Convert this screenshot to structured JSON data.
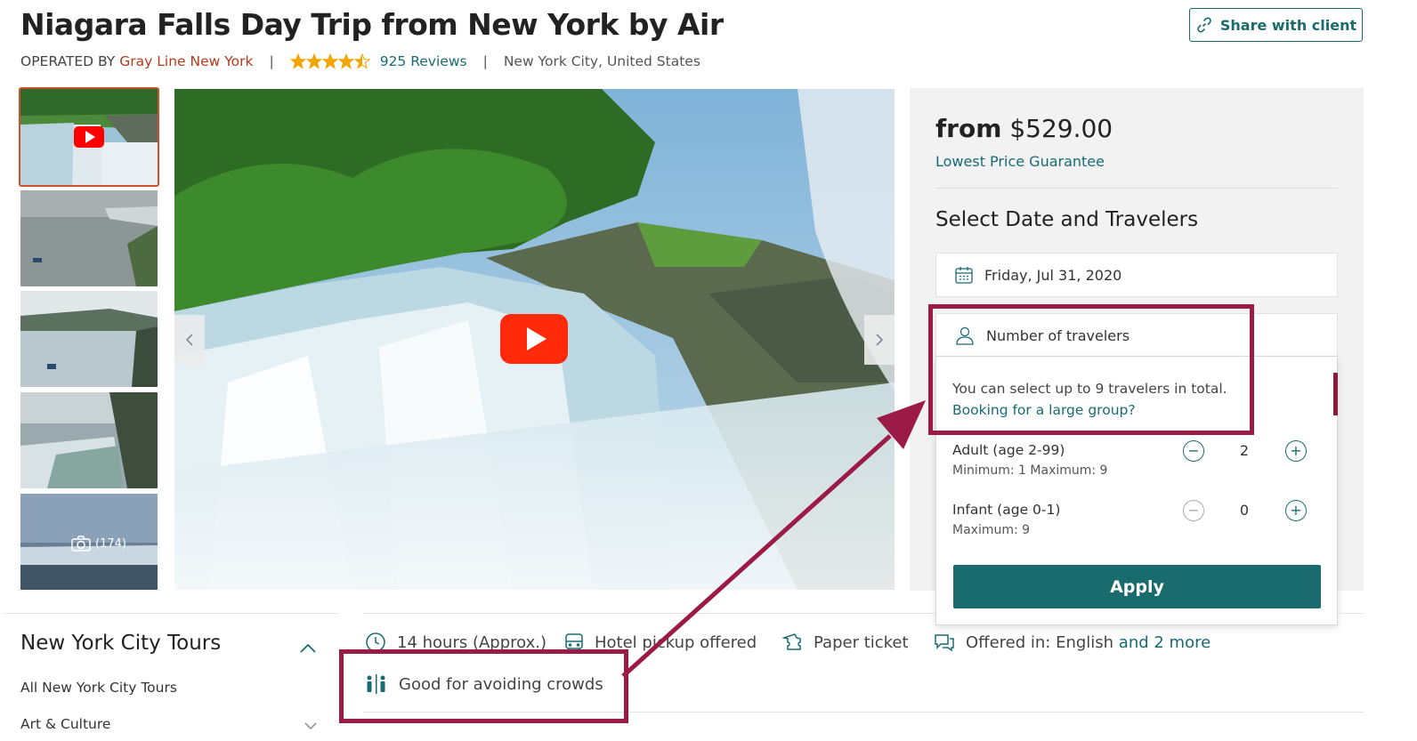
{
  "header": {
    "title": "Niagara Falls Day Trip from New York by Air",
    "operated_by_label": "OPERATED BY",
    "operator": "Gray Line New York",
    "rating": 4.5,
    "reviews": "925 Reviews",
    "location": "New York City, United States",
    "share_label": "Share with client"
  },
  "gallery": {
    "photo_count": "(174)"
  },
  "booking": {
    "from_label": "from",
    "price": "$529.00",
    "guarantee": "Lowest Price Guarantee",
    "section_title": "Select Date and Travelers",
    "date": "Friday, Jul 31, 2020",
    "travelers_label": "Number of travelers",
    "limit_text": "You can select up to 9 travelers in total.",
    "large_group_link": "Booking for a large group?",
    "travelers": [
      {
        "label": "Adult (age 2-99)",
        "sub": "Minimum: 1 Maximum: 9",
        "count": "2"
      },
      {
        "label": "Infant (age 0-1)",
        "sub": "Maximum: 9",
        "count": "0"
      }
    ],
    "apply_label": "Apply"
  },
  "sidebar": {
    "title": "New York City Tours",
    "items": [
      "All New York City Tours",
      "Art & Culture"
    ]
  },
  "features": {
    "duration": "14 hours (Approx.)",
    "pickup": "Hotel pickup offered",
    "ticket": "Paper ticket",
    "offered_in": "Offered in: English",
    "more_link": "and 2 more",
    "crowds": "Good for avoiding crowds"
  },
  "colors": {
    "brand_teal": "#1a6b6d",
    "operator_red": "#b43a1a",
    "annotation": "#9b1b46",
    "star": "#f0a500"
  },
  "icons": [
    "link-icon",
    "star-icon",
    "play-icon",
    "camera-icon",
    "calendar-icon",
    "person-icon",
    "clock-icon",
    "bus-icon",
    "ticket-icon",
    "chat-icon",
    "crowd-icon",
    "chevron-up-icon",
    "chevron-down-icon"
  ]
}
